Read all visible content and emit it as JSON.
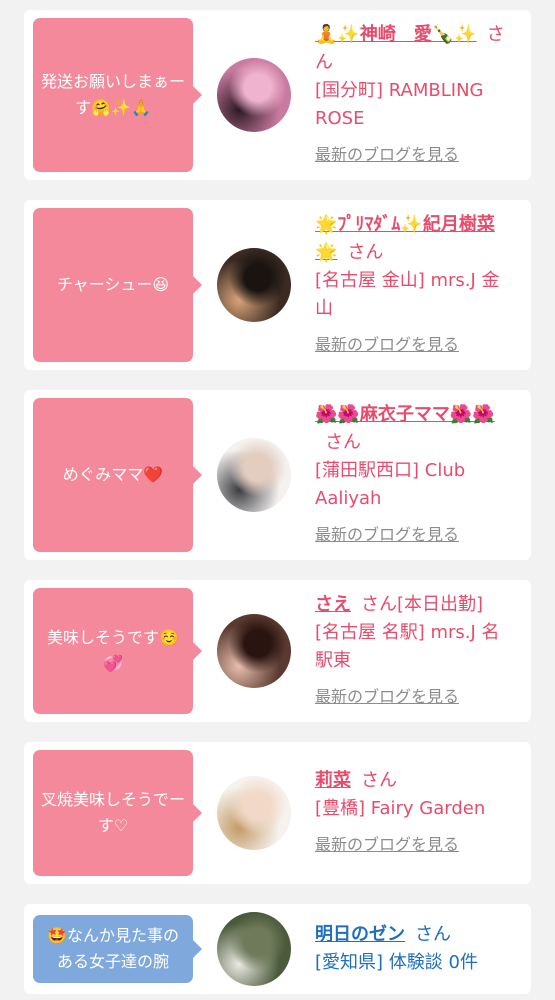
{
  "entries": [
    {
      "message": "発送お願いしまぁーす🤗✨🙏",
      "name": "🧘✨神崎　愛🍾✨",
      "suffix": "さん",
      "shop": "[国分町] RAMBLING ROSE",
      "link": "最新のブログを見る",
      "bubble_color": "#f5899c",
      "text_color": "#e94b6c",
      "avatar_colors": [
        "#c97aa0",
        "#2a1a22",
        "#f0b3cf"
      ]
    },
    {
      "message": "チャーシュー😆",
      "name": "🌟ﾌﾟﾘﾏﾀﾞﾑ✨紀月樹菜🌟",
      "suffix": "さん",
      "shop": "[名古屋 金山] mrs.J 金山",
      "link": "最新のブログを見る",
      "bubble_color": "#f5899c",
      "text_color": "#e94b6c",
      "avatar_colors": [
        "#3a2a22",
        "#d8a47a",
        "#1a1410"
      ]
    },
    {
      "message": "めぐみママ❤️",
      "name": "🌺🌺麻衣子ママ🌺🌺",
      "suffix": "さん",
      "shop": "[蒲田駅西口] Club Aaliyah",
      "link": "最新のブログを見る",
      "bubble_color": "#f5899c",
      "text_color": "#e94b6c",
      "avatar_colors": [
        "#f4f1ef",
        "#3c3c40",
        "#e3cdbf"
      ]
    },
    {
      "message": "美味しそうです☺️💞",
      "name": "さえ",
      "suffix": "さん[本日出勤]",
      "shop": "[名古屋 名駅] mrs.J 名駅東",
      "link": "最新のブログを見る",
      "bubble_color": "#f5899c",
      "text_color": "#e94b6c",
      "avatar_colors": [
        "#5a3a30",
        "#e9bfae",
        "#2a1410"
      ]
    },
    {
      "message": "叉焼美味しそうでーす♡",
      "name": "莉菜",
      "suffix": "さん",
      "shop": "[豊橋] Fairy Garden",
      "link": "最新のブログを見る",
      "bubble_color": "#f5899c",
      "text_color": "#e94b6c",
      "avatar_colors": [
        "#f6f2ee",
        "#c39a66",
        "#f2d9c7"
      ]
    },
    {
      "message": "🤩なんか見た事のある女子達の腕",
      "name": "明日のゼン",
      "suffix": "さん",
      "shop": "[愛知県] 体験談 0件",
      "link": "",
      "bubble_color": "#7fa8dc",
      "text_color": "#1f6fbf",
      "avatar_colors": [
        "#4a5a3a",
        "#eceae4",
        "#6e7a5a"
      ]
    }
  ]
}
